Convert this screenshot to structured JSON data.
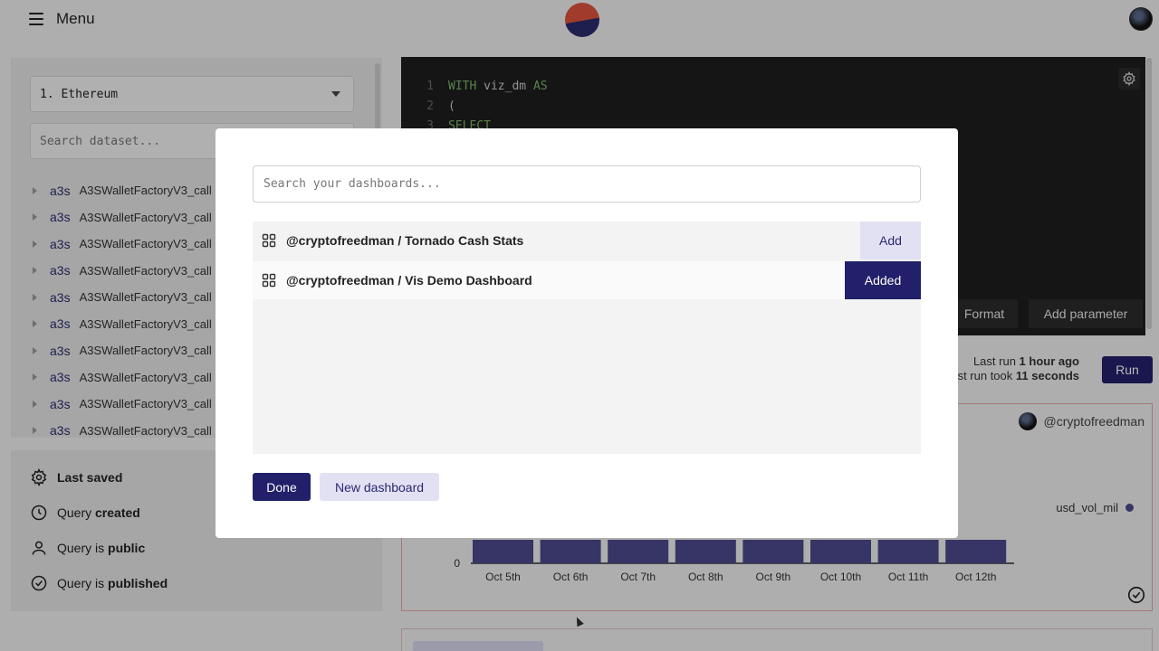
{
  "header": {
    "menu_label": "Menu"
  },
  "sidebar": {
    "chain_select": "1. Ethereum",
    "search_placeholder": "Search dataset...",
    "tables": [
      {
        "ns": "a3s",
        "name": "A3SWalletFactoryV3_call"
      },
      {
        "ns": "a3s",
        "name": "A3SWalletFactoryV3_call"
      },
      {
        "ns": "a3s",
        "name": "A3SWalletFactoryV3_call"
      },
      {
        "ns": "a3s",
        "name": "A3SWalletFactoryV3_call"
      },
      {
        "ns": "a3s",
        "name": "A3SWalletFactoryV3_call"
      },
      {
        "ns": "a3s",
        "name": "A3SWalletFactoryV3_call"
      },
      {
        "ns": "a3s",
        "name": "A3SWalletFactoryV3_call"
      },
      {
        "ns": "a3s",
        "name": "A3SWalletFactoryV3_call"
      },
      {
        "ns": "a3s",
        "name": "A3SWalletFactoryV3_call"
      },
      {
        "ns": "a3s",
        "name": "A3SWalletFactoryV3_call"
      }
    ]
  },
  "status": {
    "last_saved": "Last saved",
    "created_prefix": "Query ",
    "created_bold": "created",
    "public_prefix": "Query is ",
    "public_bold": "public",
    "published_prefix": "Query is ",
    "published_bold": "published"
  },
  "editor": {
    "lines": [
      {
        "n": "1",
        "kw1": "WITH",
        "plain": " viz_dm ",
        "kw2": "AS"
      },
      {
        "n": "2",
        "kw1": "",
        "plain": "(",
        "kw2": ""
      },
      {
        "n": "3",
        "kw1": "SELECT",
        "plain": "",
        "kw2": ""
      }
    ],
    "format_label": "Format",
    "add_parameter_label": "Add parameter"
  },
  "run": {
    "last_run_prefix": "Last run ",
    "last_run_value": "1 hour ago",
    "took_prefix": "Last run took ",
    "took_value": "11 seconds",
    "run_label": "Run"
  },
  "chart": {
    "author": "@cryptofreedman",
    "legend": "usd_vol_mil",
    "y_zero_label": "0",
    "colors": {
      "bar": "#4b4a8c"
    }
  },
  "chart_data": {
    "type": "bar",
    "categories": [
      "Oct 5th",
      "Oct 6th",
      "Oct 7th",
      "Oct 8th",
      "Oct 9th",
      "Oct 10th",
      "Oct 11th",
      "Oct 12th"
    ],
    "series": [
      {
        "name": "usd_vol_mil",
        "values": [
          1,
          1,
          1,
          1,
          1,
          1,
          1,
          1
        ]
      }
    ],
    "ylim": [
      0,
      1
    ],
    "visible_fraction_note": "bars partially occluded by modal"
  },
  "modal": {
    "search_placeholder": "Search your dashboards...",
    "dashboards": [
      {
        "name": "@cryptofreedman / Tornado Cash Stats",
        "action": "Add"
      },
      {
        "name": "@cryptofreedman / Vis Demo Dashboard",
        "action": "Added"
      }
    ],
    "done_label": "Done",
    "new_dashboard_label": "New dashboard"
  }
}
